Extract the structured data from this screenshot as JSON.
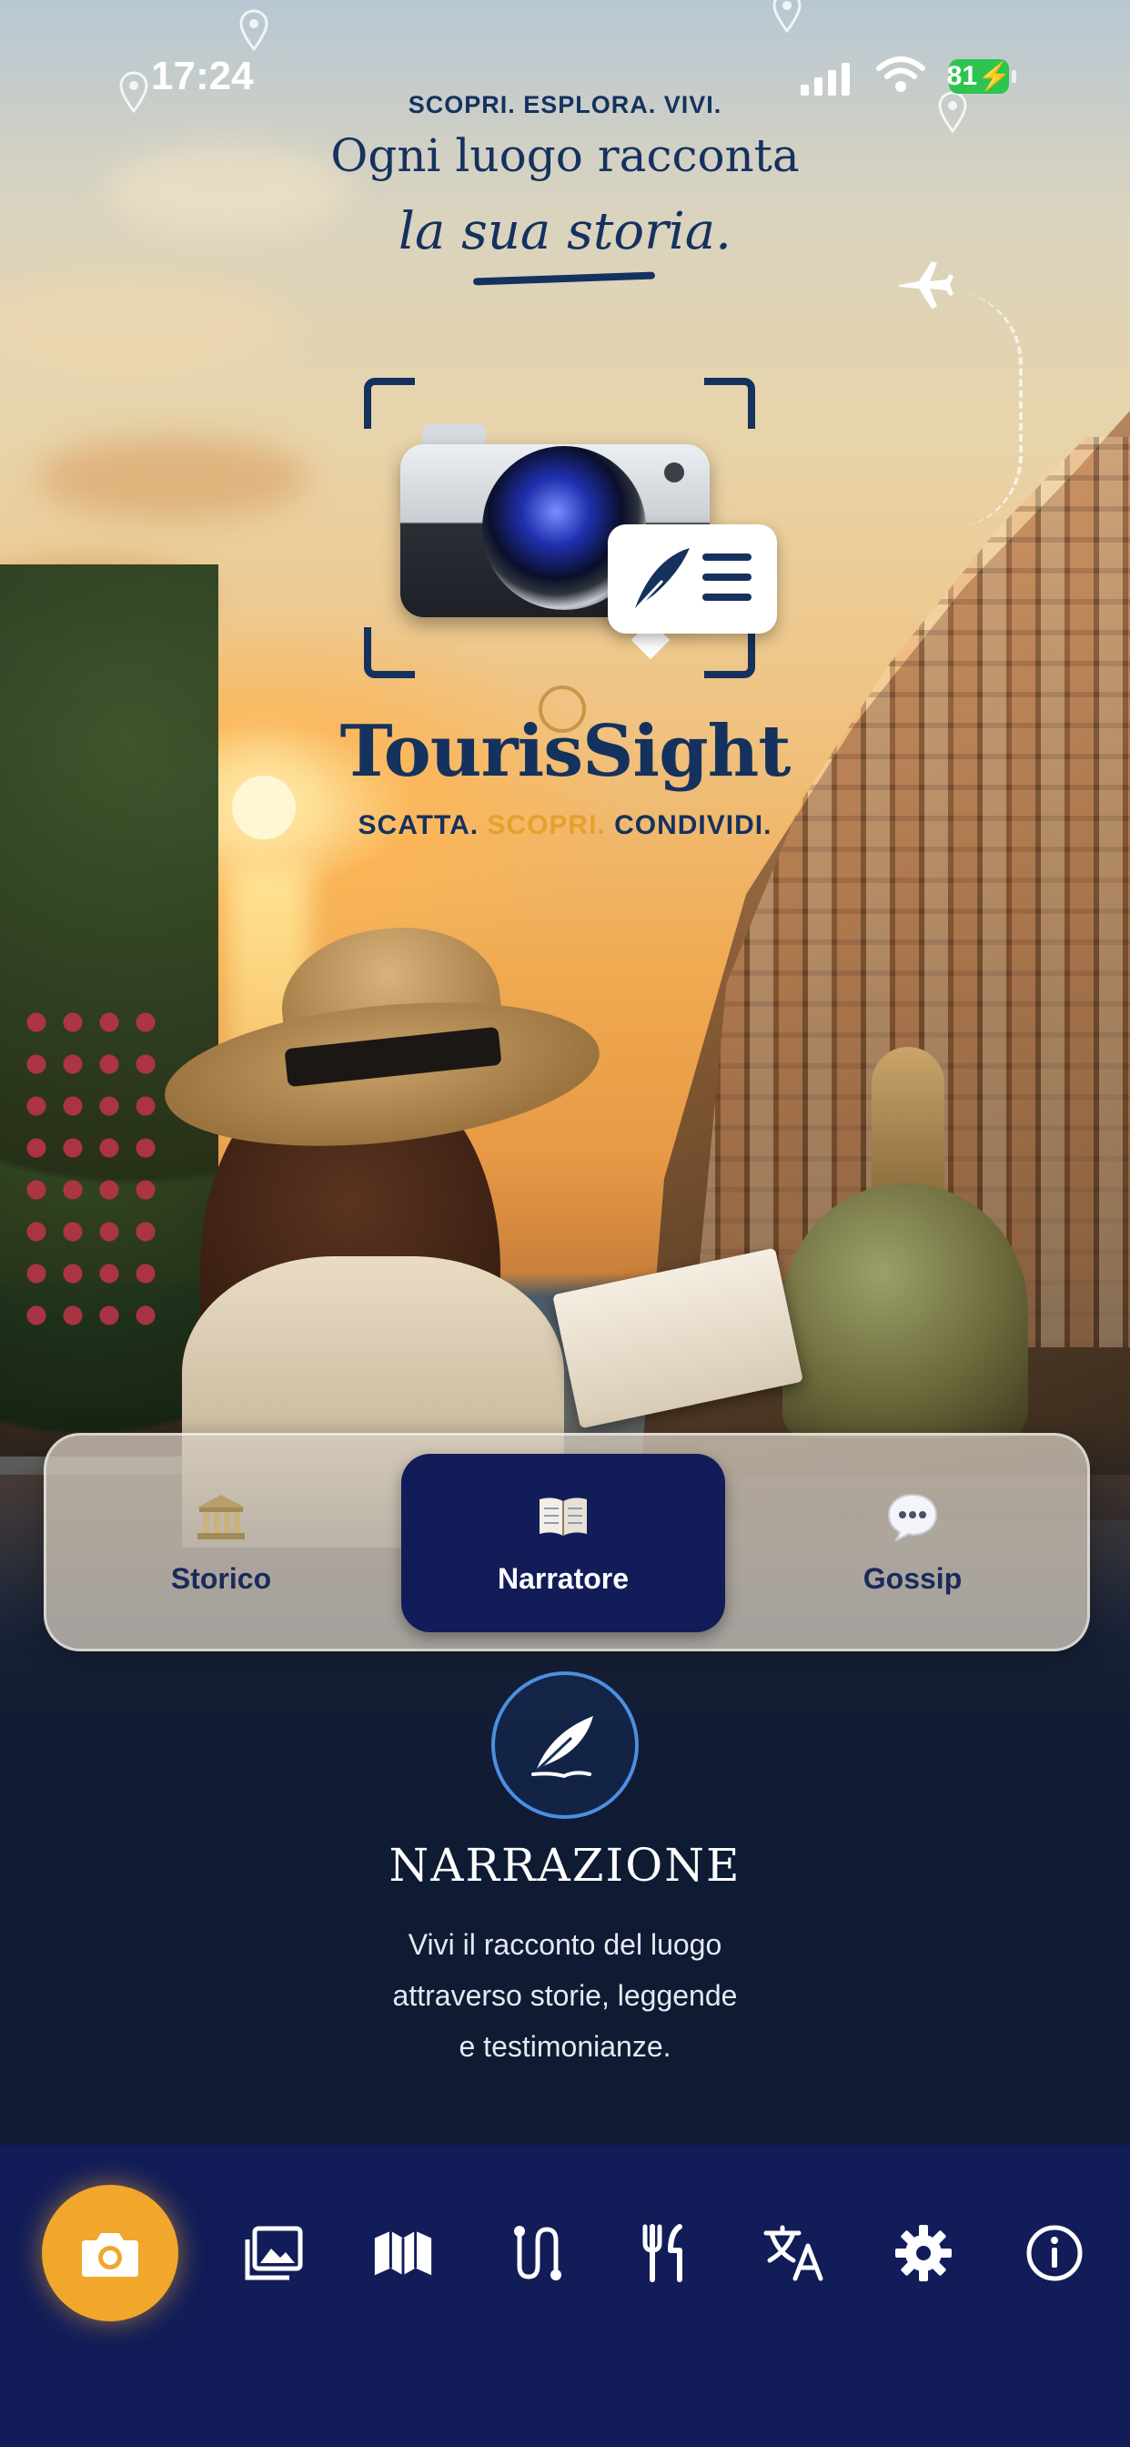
{
  "status_bar": {
    "time": "17:24",
    "battery": "81"
  },
  "header": {
    "tagline": "SCOPRI. ESPLORA. VIVI.",
    "headline_line1": "Ogni luogo racconta",
    "headline_line2": "la sua storia."
  },
  "brand": {
    "name": "TourisSight",
    "slogan_part1": "SCATTA. ",
    "slogan_part2": "SCOPRI.",
    "slogan_part3": " CONDIVIDI."
  },
  "modes": [
    {
      "label": "Storico",
      "icon": "museum-icon",
      "active": false
    },
    {
      "label": "Narratore",
      "icon": "book-icon",
      "active": true
    },
    {
      "label": "Gossip",
      "icon": "speech-bubble-icon",
      "active": false
    }
  ],
  "info": {
    "icon": "feather-icon",
    "title": "NARRAZIONE",
    "description_lines": [
      "Vivi il racconto del luogo",
      "attraverso storie, leggende",
      "e testimonianze."
    ]
  },
  "bottom_nav": {
    "items": [
      "camera-icon",
      "gallery-icon",
      "map-icon",
      "route-icon",
      "restaurant-icon",
      "translate-icon",
      "settings-icon",
      "info-icon"
    ]
  },
  "colors": {
    "brand_navy": "#15315e",
    "nav_background": "#111c58",
    "accent_orange": "#f0a72c",
    "active_mode": "#111c58"
  }
}
